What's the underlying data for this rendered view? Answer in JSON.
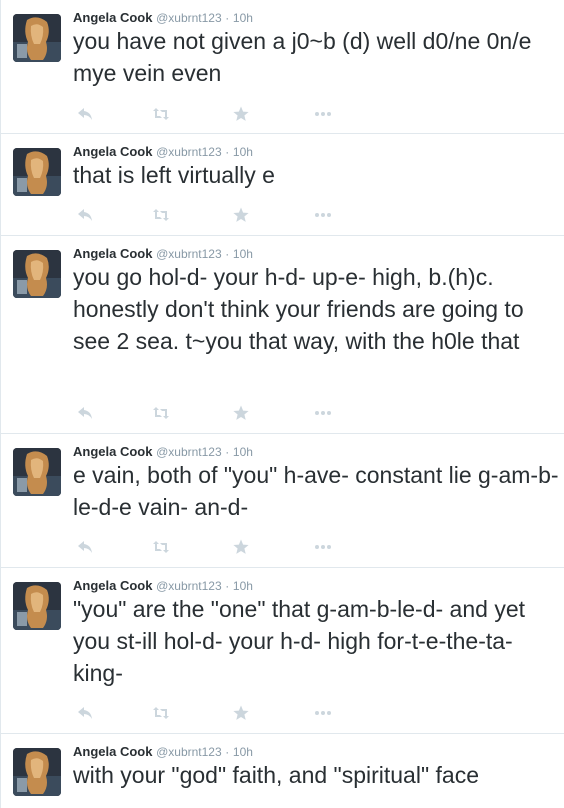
{
  "colors": {
    "icon": "#ccd6dd",
    "meta": "#8899a6",
    "text": "#292f33",
    "divider": "#e1e8ed"
  },
  "icons": {
    "reply": "reply-icon",
    "retweet": "retweet-icon",
    "favorite": "star-icon",
    "more": "more-icon"
  },
  "tweets": [
    {
      "name": "Angela Cook",
      "handle": "@xubrnt123",
      "sep": "·",
      "time": "10h",
      "text": "you have not given a j0~b (d) well d0/ne 0n/e mye vein even"
    },
    {
      "name": "Angela Cook",
      "handle": "@xubrnt123",
      "sep": "·",
      "time": "10h",
      "text": "that is left virtually e"
    },
    {
      "name": "Angela Cook",
      "handle": "@xubrnt123",
      "sep": "·",
      "time": "10h",
      "text": "you go hol-d- your h-d- up-e- high, b.(h)c. honestly don't think your friends are going to see 2 sea. t~you that way, with the h0le that"
    },
    {
      "name": "Angela Cook",
      "handle": "@xubrnt123",
      "sep": "·",
      "time": "10h",
      "text": "e vain, both of \"you\" h-ave- constant lie g-am-b-le-d-e vain- an-d-"
    },
    {
      "name": "Angela Cook",
      "handle": "@xubrnt123",
      "sep": "·",
      "time": "10h",
      "text": "\"you\" are the \"one\" that g-am-b-le-d- and yet you st-ill hol-d- your h-d- high for-t-e-the-ta-king-"
    },
    {
      "name": "Angela Cook",
      "handle": "@xubrnt123",
      "sep": "·",
      "time": "10h",
      "text": "with your \"god\" faith, and \"spiritual\" face"
    }
  ]
}
